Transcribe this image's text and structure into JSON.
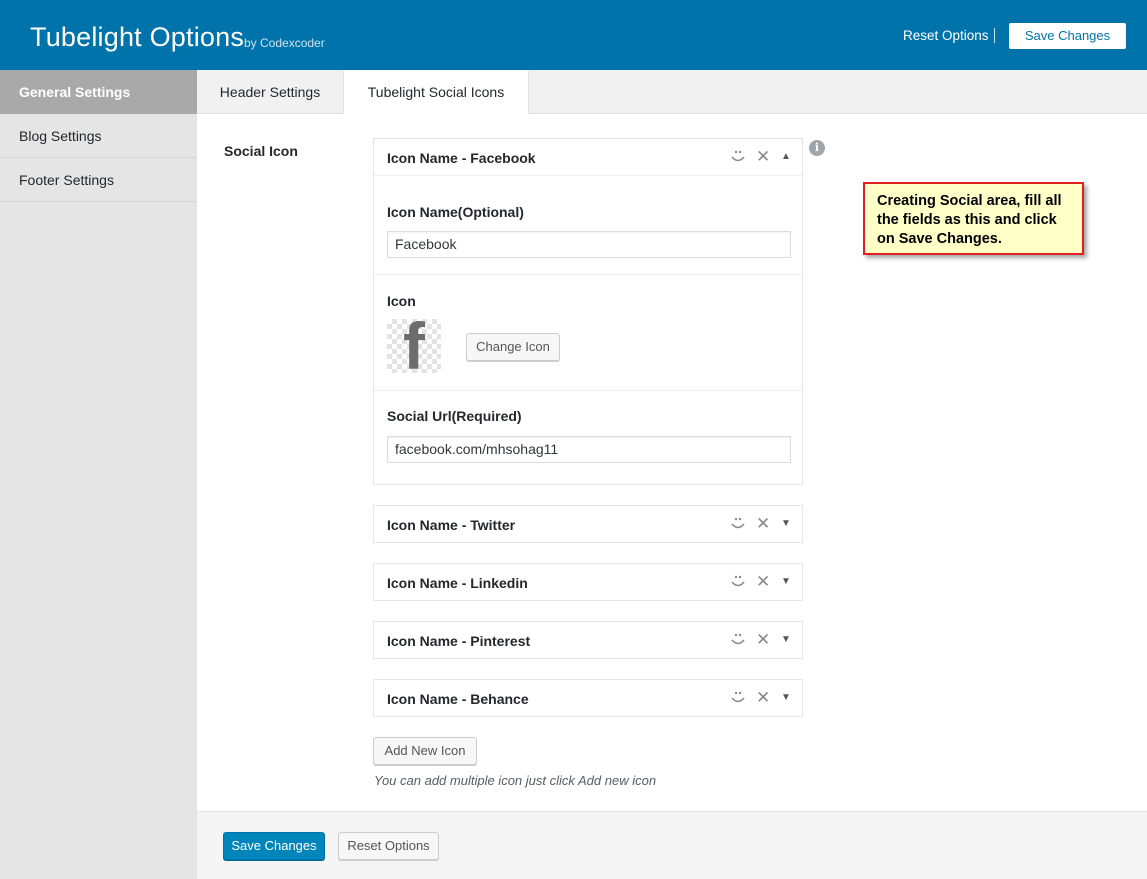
{
  "header": {
    "title": "Tubelight Options",
    "byline": "by Codexcoder",
    "reset_label": "Reset Options",
    "save_label": "Save Changes"
  },
  "sidebar": {
    "items": [
      {
        "label": "General Settings",
        "active": true
      },
      {
        "label": "Blog Settings",
        "active": false
      },
      {
        "label": "Footer Settings",
        "active": false
      }
    ]
  },
  "tabs": [
    {
      "label": "Header Settings",
      "active": false
    },
    {
      "label": "Tubelight Social Icons",
      "active": true
    }
  ],
  "social": {
    "field_label": "Social Icon",
    "info_glyph": "i",
    "items": [
      {
        "title": "Icon Name - Facebook",
        "expanded": true,
        "name_label": "Icon Name(Optional)",
        "name_value": "Facebook",
        "icon_label": "Icon",
        "icon_glyph": "f",
        "change_icon_label": "Change Icon",
        "url_label": "Social Url(Required)",
        "url_value": "facebook.com/mhsohag11"
      },
      {
        "title": "Icon Name - Twitter",
        "expanded": false
      },
      {
        "title": "Icon Name - Linkedin",
        "expanded": false
      },
      {
        "title": "Icon Name - Pinterest",
        "expanded": false
      },
      {
        "title": "Icon Name - Behance",
        "expanded": false
      }
    ],
    "close_glyph": "✕",
    "expanded_glyph": "▲",
    "collapsed_glyph": "▼",
    "add_label": "Add New Icon",
    "hint": "You can add multiple icon just click Add new icon"
  },
  "footer": {
    "save_label": "Save Changes",
    "reset_label": "Reset Options"
  },
  "callout": {
    "text": "Creating Social area, fill all the fields as this and click on Save Changes."
  },
  "colors": {
    "brand": "#0073aa",
    "primary_button": "#0085ba",
    "sidebar_active": "#a9a9a9",
    "callout_border": "#e02020",
    "callout_bg": "#ffffc8"
  }
}
